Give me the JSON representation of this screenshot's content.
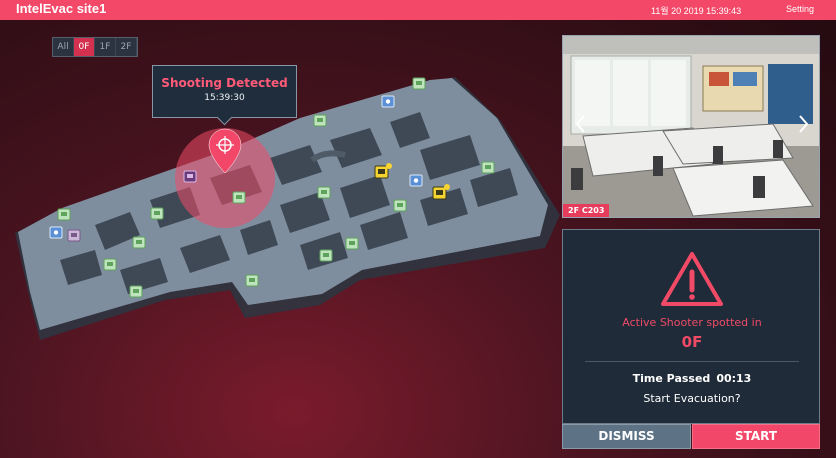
{
  "header": {
    "app_title": "IntelEvac site1",
    "datetime": "11월 20 2019 15:39:43",
    "setting_label": "Setting"
  },
  "floor_tabs": [
    {
      "label": "All",
      "active": false
    },
    {
      "label": "0F",
      "active": true
    },
    {
      "label": "1F",
      "active": false
    },
    {
      "label": "2F",
      "active": false
    }
  ],
  "map": {
    "alert_title": "Shooting Detected",
    "alert_time": "15:39:30",
    "sensor_icons": [
      "green-monitor-icon",
      "blue-camera-icon",
      "yellow-warning-icon",
      "purple-sensor-icon"
    ],
    "marker_icon": "location-pin-crosshair-icon",
    "alert_color": "#f04a67"
  },
  "camera": {
    "location_label": "2F  C203",
    "prev_icon": "chevron-left-icon",
    "next_icon": "chevron-right-icon"
  },
  "alert_panel": {
    "warning_icon": "warning-triangle-icon",
    "message": "Active Shooter spotted in",
    "floor": "0F",
    "time_passed_label": "Time Passed",
    "time_passed_value": "00:13",
    "question": "Start Evacuation?",
    "dismiss_label": "DISMISS",
    "start_label": "START"
  },
  "colors": {
    "accent": "#f44868",
    "panel_bg": "#1f2b38",
    "dismiss_bg": "#5d7285"
  }
}
